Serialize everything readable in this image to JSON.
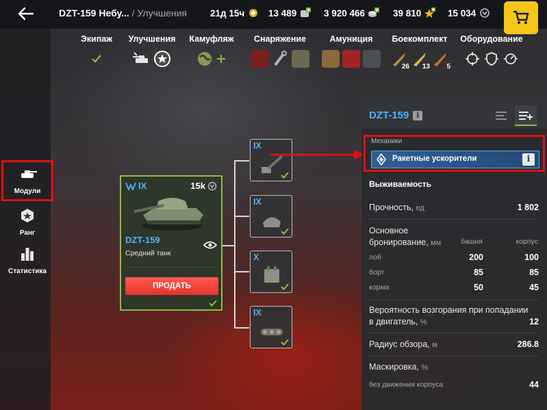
{
  "header": {
    "tank_name": "DZT-159 Небу...",
    "separator": "/",
    "section": "Улучшения",
    "premium_time": "21д 15ч",
    "free_xp": "13 489",
    "credits": "3 920 466",
    "gold": "39 810",
    "combat_xp": "15 034"
  },
  "categories": [
    {
      "label": "Экипаж"
    },
    {
      "label": "Улучшения"
    },
    {
      "label": "Камуфляж"
    },
    {
      "label": "Снаряжение"
    },
    {
      "label": "Амуниция"
    },
    {
      "label": "Боекомплект",
      "counts": [
        "26",
        "13",
        "5"
      ]
    },
    {
      "label": "Оборудование"
    }
  ],
  "sidebar": {
    "items": [
      {
        "label": "Модули",
        "icon": "tank-icon",
        "active": true
      },
      {
        "label": "Ранг",
        "icon": "rank-icon"
      },
      {
        "label": "Статистика",
        "icon": "stats-icon"
      }
    ]
  },
  "tank_card": {
    "tier": "IX",
    "price": "15k",
    "name": "DZT-159",
    "type": "Средний танк",
    "sell_label": "ПРОДАТЬ"
  },
  "modules": [
    {
      "tier": "IX",
      "icon": "gun-icon"
    },
    {
      "tier": "IX",
      "icon": "turret-icon"
    },
    {
      "tier": "X",
      "icon": "engine-icon"
    },
    {
      "tier": "IX",
      "icon": "tracks-icon"
    }
  ],
  "panel": {
    "title": "DZT-159",
    "mechanics_label": "Механики",
    "mechanic_name": "Ракетные ускорители",
    "survivability_title": "Выживаемость",
    "durability": {
      "label": "Прочность,",
      "unit": "ед",
      "value": "1 802"
    },
    "armor": {
      "label_line1": "Основное",
      "label_line2": "бронирование,",
      "unit": "мм",
      "col_turret": "башня",
      "col_hull": "корпус",
      "rows": [
        {
          "label": "лоб",
          "turret": "200",
          "hull": "100"
        },
        {
          "label": "борт",
          "turret": "85",
          "hull": "85"
        },
        {
          "label": "корма",
          "turret": "50",
          "hull": "45"
        }
      ]
    },
    "fire_chance": {
      "label_line1": "Вероятность возгорания при попадании",
      "label_line2": "в двигатель,",
      "unit": "%",
      "value": "12"
    },
    "view_range": {
      "label": "Радиус обзора,",
      "unit": "м",
      "value": "286.8"
    },
    "camo": {
      "label": "Маскировка,",
      "unit": "%"
    },
    "camo_still": {
      "label": "без движения корпуса",
      "value": "44"
    }
  },
  "colors": {
    "accent_blue": "#4fb3ff",
    "accent_green": "#8fbf3f",
    "sell_red": "#e3342b",
    "highlight_red": "#e01010",
    "gold_yellow": "#f5c518"
  }
}
